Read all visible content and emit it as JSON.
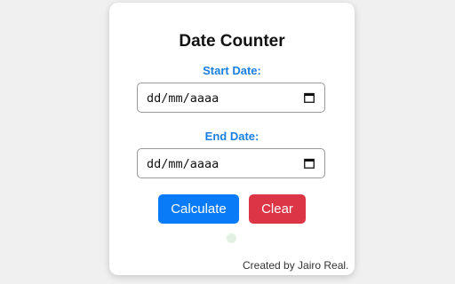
{
  "card": {
    "title": "Date Counter",
    "start": {
      "label": "Start Date:",
      "value_placeholder": "dd/mm/aaaa",
      "icon": "calendar-icon"
    },
    "end": {
      "label": "End Date:",
      "value_placeholder": "dd/mm/aaaa",
      "icon": "calendar-icon"
    },
    "buttons": {
      "calculate_label": "Calculate",
      "clear_label": "Clear"
    }
  },
  "footer": {
    "credit": "Created by Jairo Real."
  },
  "colors": {
    "label_blue": "#1a7fe0",
    "calculate_blue": "#0a7bf6",
    "clear_red": "#dc3545",
    "background": "#f0f0f0"
  }
}
